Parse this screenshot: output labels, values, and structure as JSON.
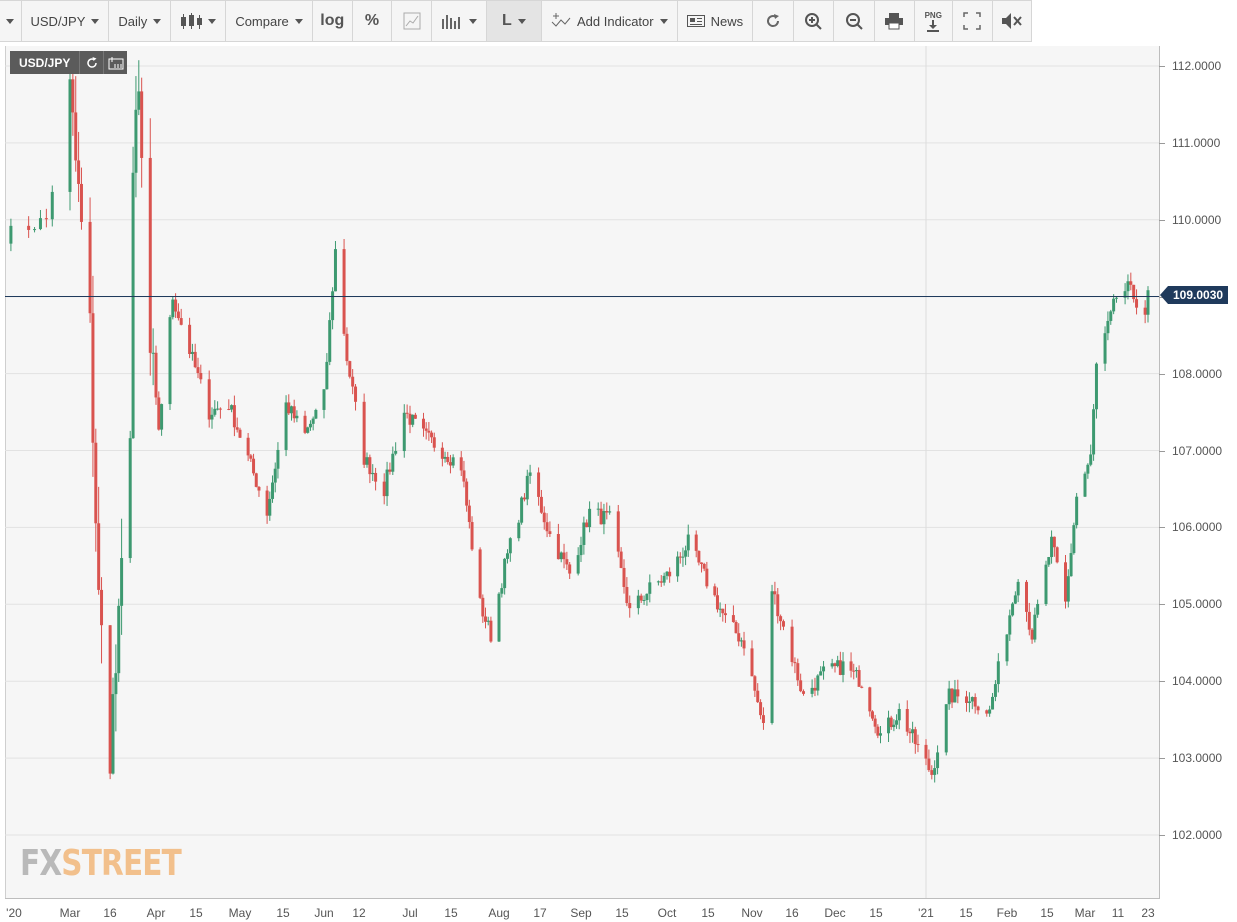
{
  "toolbar": {
    "symbol": "USD/JPY",
    "interval": "Daily",
    "compare": "Compare",
    "log": "log",
    "percent": "%",
    "line": "L",
    "add_indicator": "Add Indicator",
    "news": "News",
    "png": "PNG"
  },
  "pair_label": "USD/JPY",
  "current_price": "109.0030",
  "watermark": {
    "part1": "FX",
    "part2": "STREET"
  },
  "colors": {
    "up": "#3d9970",
    "down": "#d9534f",
    "price_line": "#1f3a5c"
  },
  "chart_data": {
    "type": "candlestick",
    "title": "USD/JPY",
    "interval": "Daily",
    "ylim": [
      101.2,
      112.1
    ],
    "y_ticks": [
      "112.0000",
      "111.0000",
      "110.0000",
      "109.0000",
      "108.0000",
      "107.0000",
      "106.0000",
      "105.0000",
      "104.0000",
      "103.0000",
      "102.0000"
    ],
    "x_ticks": [
      "'20",
      "Mar",
      "16",
      "Apr",
      "15",
      "May",
      "15",
      "Jun",
      "12",
      "Jul",
      "15",
      "Aug",
      "17",
      "Sep",
      "15",
      "Oct",
      "15",
      "Nov",
      "16",
      "Dec",
      "15",
      "'21",
      "15",
      "Feb",
      "15",
      "Mar",
      "11",
      "23"
    ],
    "current_price": 109.003,
    "close_path": [
      {
        "d": "2020-02-20",
        "c": 109.8
      },
      {
        "d": "2020-02-27",
        "c": 110.0
      },
      {
        "d": "2020-03-02",
        "c": 111.6
      },
      {
        "d": "2020-03-05",
        "c": 110.3
      },
      {
        "d": "2020-03-09",
        "c": 108.5
      },
      {
        "d": "2020-03-12",
        "c": 105.0
      },
      {
        "d": "2020-03-16",
        "c": 103.2
      },
      {
        "d": "2020-03-19",
        "c": 104.6
      },
      {
        "d": "2020-03-23",
        "c": 107.5
      },
      {
        "d": "2020-03-24",
        "c": 110.6
      },
      {
        "d": "2020-03-26",
        "c": 111.5
      },
      {
        "d": "2020-03-30",
        "c": 108.2
      },
      {
        "d": "2020-04-02",
        "c": 107.3
      },
      {
        "d": "2020-04-07",
        "c": 109.0
      },
      {
        "d": "2020-04-13",
        "c": 108.3
      },
      {
        "d": "2020-04-20",
        "c": 107.5
      },
      {
        "d": "2020-04-27",
        "c": 107.6
      },
      {
        "d": "2020-05-04",
        "c": 106.9
      },
      {
        "d": "2020-05-11",
        "c": 106.2
      },
      {
        "d": "2020-05-18",
        "c": 107.6
      },
      {
        "d": "2020-05-25",
        "c": 107.2
      },
      {
        "d": "2020-06-01",
        "c": 107.7
      },
      {
        "d": "2020-06-05",
        "c": 109.6
      },
      {
        "d": "2020-06-09",
        "c": 108.2
      },
      {
        "d": "2020-06-15",
        "c": 106.9
      },
      {
        "d": "2020-06-22",
        "c": 106.5
      },
      {
        "d": "2020-06-29",
        "c": 107.5
      },
      {
        "d": "2020-07-06",
        "c": 107.2
      },
      {
        "d": "2020-07-13",
        "c": 107.0
      },
      {
        "d": "2020-07-20",
        "c": 106.8
      },
      {
        "d": "2020-07-27",
        "c": 105.0
      },
      {
        "d": "2020-07-31",
        "c": 104.6
      },
      {
        "d": "2020-08-05",
        "c": 105.5
      },
      {
        "d": "2020-08-14",
        "c": 106.7
      },
      {
        "d": "2020-08-21",
        "c": 105.9
      },
      {
        "d": "2020-08-28",
        "c": 105.4
      },
      {
        "d": "2020-09-04",
        "c": 106.2
      },
      {
        "d": "2020-09-11",
        "c": 106.1
      },
      {
        "d": "2020-09-18",
        "c": 104.9
      },
      {
        "d": "2020-09-25",
        "c": 105.2
      },
      {
        "d": "2020-10-02",
        "c": 105.4
      },
      {
        "d": "2020-10-09",
        "c": 105.8
      },
      {
        "d": "2020-10-16",
        "c": 105.3
      },
      {
        "d": "2020-10-23",
        "c": 104.8
      },
      {
        "d": "2020-10-30",
        "c": 104.5
      },
      {
        "d": "2020-11-06",
        "c": 103.4
      },
      {
        "d": "2020-11-09",
        "c": 105.2
      },
      {
        "d": "2020-11-13",
        "c": 104.7
      },
      {
        "d": "2020-11-20",
        "c": 103.8
      },
      {
        "d": "2020-11-27",
        "c": 104.1
      },
      {
        "d": "2020-12-04",
        "c": 104.2
      },
      {
        "d": "2020-12-11",
        "c": 104.0
      },
      {
        "d": "2020-12-18",
        "c": 103.3
      },
      {
        "d": "2020-12-25",
        "c": 103.6
      },
      {
        "d": "2020-12-31",
        "c": 103.2
      },
      {
        "d": "2021-01-06",
        "c": 102.8
      },
      {
        "d": "2021-01-12",
        "c": 103.8
      },
      {
        "d": "2021-01-19",
        "c": 103.8
      },
      {
        "d": "2021-01-26",
        "c": 103.6
      },
      {
        "d": "2021-02-01",
        "c": 104.7
      },
      {
        "d": "2021-02-05",
        "c": 105.4
      },
      {
        "d": "2021-02-10",
        "c": 104.6
      },
      {
        "d": "2021-02-17",
        "c": 105.8
      },
      {
        "d": "2021-02-22",
        "c": 105.0
      },
      {
        "d": "2021-02-26",
        "c": 106.4
      },
      {
        "d": "2021-03-03",
        "c": 106.9
      },
      {
        "d": "2021-03-05",
        "c": 108.1
      },
      {
        "d": "2021-03-09",
        "c": 108.6
      },
      {
        "d": "2021-03-12",
        "c": 109.0
      },
      {
        "d": "2021-03-16",
        "c": 109.1
      },
      {
        "d": "2021-03-22",
        "c": 108.8
      },
      {
        "d": "2021-03-23",
        "c": 109.0
      }
    ]
  }
}
